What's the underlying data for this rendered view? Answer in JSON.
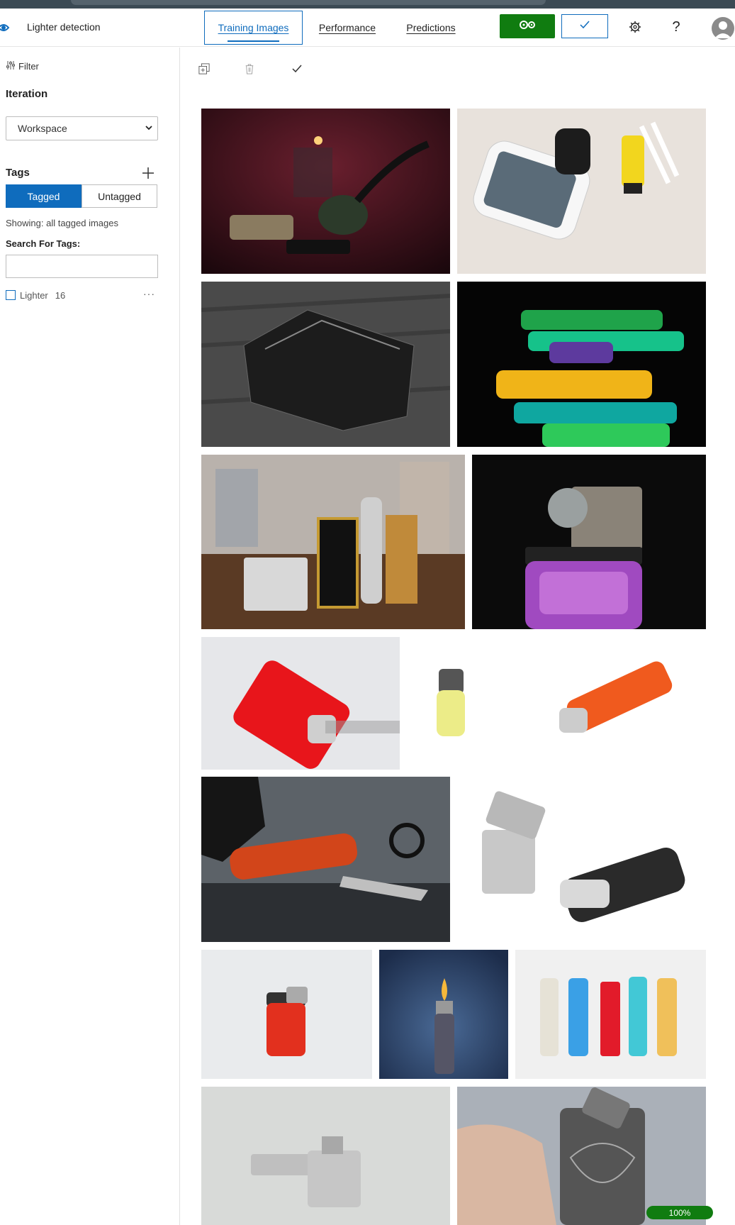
{
  "app": {
    "title": "Lighter detection"
  },
  "header": {
    "tabs": [
      {
        "label": "Training Images",
        "active": true
      },
      {
        "label": "Performance",
        "active": false
      },
      {
        "label": "Predictions",
        "active": false
      }
    ],
    "train_icon": "gears-icon",
    "quick_test_icon": "check-icon",
    "settings_icon": "gear-icon",
    "help_label": "?",
    "colors": {
      "accent": "#0f6cbd",
      "train": "#107c10"
    }
  },
  "sidebar": {
    "filter_label": "Filter",
    "iteration": {
      "title": "Iteration",
      "selected": "Workspace"
    },
    "tags": {
      "title": "Tags",
      "toggle": [
        "Tagged",
        "Untagged"
      ],
      "active_toggle": "Tagged",
      "showing": "Showing: all tagged images",
      "search_label": "Search For Tags:",
      "search_value": "",
      "items": [
        {
          "name": "Lighter",
          "count": "16",
          "checked": false
        }
      ]
    }
  },
  "toolbar": {
    "icons": [
      "add-images-icon",
      "delete-icon",
      "select-all-icon"
    ]
  },
  "gallery": {
    "images": [
      "pipe-candle-lighter-photo",
      "phone-keyfob-lighter-photo",
      "zippo-engraved-photo",
      "colorful-disposable-lighters-photo",
      "luxury-lighters-table-photo",
      "lux-purple-lighter-photo",
      "red-lighter-istock-photo",
      "yellow-small-lighter-photo",
      "orange-lighter-photo",
      "lighter-keys-hand-photo",
      "silver-zippo-black-lighter-photo",
      "red-mini-lighter-photo",
      "flame-lighter-blue-photo",
      "multicolor-lighters-row-photo",
      "silver-zippo-open-photo",
      "hand-engraved-lighter-photo"
    ]
  },
  "status": {
    "progress_label": "100%",
    "progress": 1.0
  }
}
